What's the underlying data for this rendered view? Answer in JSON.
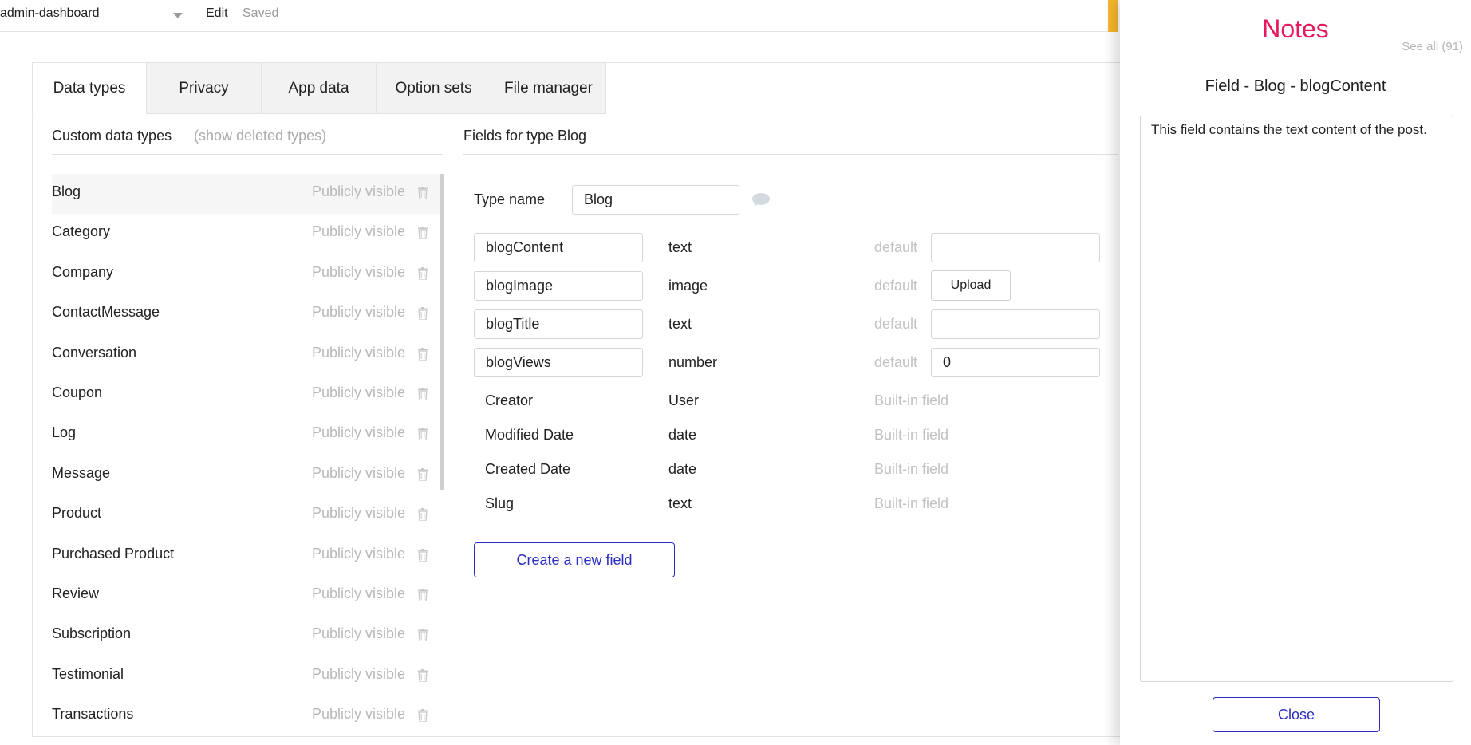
{
  "topbar": {
    "app_name": "admin-dashboard",
    "edit_label": "Edit",
    "saved_label": "Saved"
  },
  "tabs": [
    {
      "label": "Data types",
      "active": true
    },
    {
      "label": "Privacy",
      "active": false
    },
    {
      "label": "App data",
      "active": false
    },
    {
      "label": "Option sets",
      "active": false
    },
    {
      "label": "File manager",
      "active": false
    }
  ],
  "left": {
    "header": "Custom data types",
    "show_deleted": "(show deleted types)",
    "selected": "Blog",
    "types": [
      {
        "name": "Blog",
        "visibility": "Publicly visible"
      },
      {
        "name": "Category",
        "visibility": "Publicly visible"
      },
      {
        "name": "Company",
        "visibility": "Publicly visible"
      },
      {
        "name": "ContactMessage",
        "visibility": "Publicly visible"
      },
      {
        "name": "Conversation",
        "visibility": "Publicly visible"
      },
      {
        "name": "Coupon",
        "visibility": "Publicly visible"
      },
      {
        "name": "Log",
        "visibility": "Publicly visible"
      },
      {
        "name": "Message",
        "visibility": "Publicly visible"
      },
      {
        "name": "Product",
        "visibility": "Publicly visible"
      },
      {
        "name": "Purchased Product",
        "visibility": "Publicly visible"
      },
      {
        "name": "Review",
        "visibility": "Publicly visible"
      },
      {
        "name": "Subscription",
        "visibility": "Publicly visible"
      },
      {
        "name": "Testimonial",
        "visibility": "Publicly visible"
      },
      {
        "name": "Transactions",
        "visibility": "Publicly visible"
      }
    ]
  },
  "right": {
    "header": "Fields for type Blog",
    "type_name_label": "Type name",
    "type_name_value": "Blog",
    "fields": [
      {
        "name": "blogContent",
        "type": "text",
        "default_label": "default",
        "default_value": ""
      },
      {
        "name": "blogImage",
        "type": "image",
        "default_label": "default",
        "upload_label": "Upload"
      },
      {
        "name": "blogTitle",
        "type": "text",
        "default_label": "default",
        "default_value": ""
      },
      {
        "name": "blogViews",
        "type": "number",
        "default_label": "default",
        "default_value": "0"
      }
    ],
    "builtin": [
      {
        "name": "Creator",
        "type": "User",
        "label": "Built-in field"
      },
      {
        "name": "Modified Date",
        "type": "date",
        "label": "Built-in field"
      },
      {
        "name": "Created Date",
        "type": "date",
        "label": "Built-in field"
      },
      {
        "name": "Slug",
        "type": "text",
        "label": "Built-in field"
      }
    ],
    "create_button": "Create a new field"
  },
  "notes": {
    "title": "Notes",
    "see_all": "See all (91)",
    "subtitle": "Field - Blog - blogContent",
    "text": "This field contains the text content of the post.",
    "close_label": "Close"
  },
  "colors": {
    "accent_blue": "#2b2fbf",
    "notes_pink": "#e8195b",
    "muted_gray": "#b9b9b9",
    "yellow": "#f5b82e"
  }
}
